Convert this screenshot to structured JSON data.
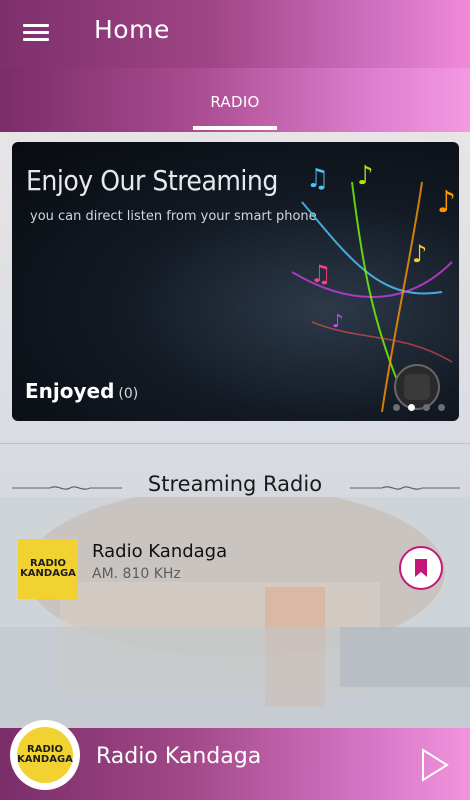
{
  "app_bar": {
    "title": "Home",
    "menu_icon": "hamburger-menu-icon"
  },
  "tabs": [
    {
      "label": "RADIO",
      "active": true
    }
  ],
  "banner": {
    "title": "Enjoy Our Streaming",
    "subtitle": "you can direct listen from your smart phone",
    "enjoyed_label": "Enjoyed",
    "enjoyed_count": "(0)",
    "slides": 4,
    "active_slide": 1
  },
  "section": {
    "title": "Streaming Radio"
  },
  "stations": [
    {
      "name": "Radio Kandaga",
      "frequency": "AM. 810 KHz",
      "logo_text": "RADIO KANDAGA",
      "bookmark_icon": "bookmark-icon"
    }
  ],
  "player": {
    "title": "Radio Kandaga",
    "play_icon": "play-icon"
  },
  "colors": {
    "accent": "#a04585",
    "accent_light": "#f08ad8",
    "bookmark": "#c2187a",
    "logo_yellow": "#f2d231"
  }
}
